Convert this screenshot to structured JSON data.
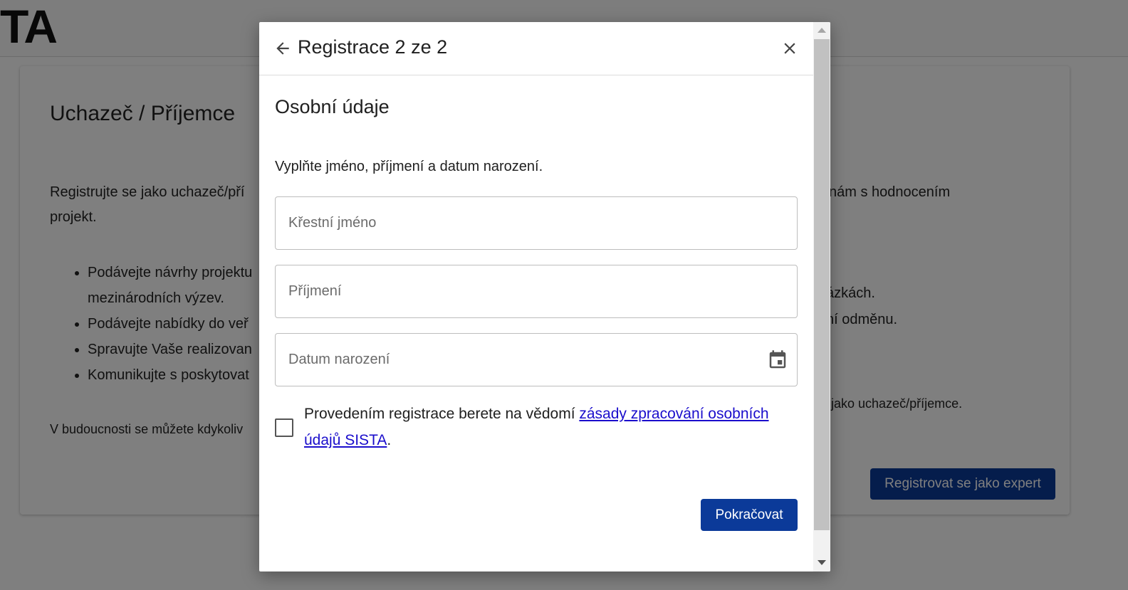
{
  "background": {
    "logo": "TA",
    "card_title": "Uchazeč / Příjemce",
    "paragraph_line1": "Registrujte se jako uchazeč/pří",
    "paragraph_line1_right": "nám s hodnocením",
    "paragraph_line2": "projekt.",
    "list_items": [
      "Podávejte návrhy projektu",
      "mezinárodních výzev.",
      "Podávejte nabídky do veř",
      "Spravujte Vaše realizovan",
      "Komunikujte s poskytovat"
    ],
    "right_text_1": "ázkách.",
    "right_text_2": "ní odměnu.",
    "small_left": "V budoucnosti se můžete kdykoliv",
    "small_right": "i jako uchazeč/příjemce.",
    "expert_button": "Registrovat se jako expert"
  },
  "modal": {
    "title": "Registrace 2 ze 2",
    "section_title": "Osobní údaje",
    "instructions": "Vyplňte jméno, příjmení a datum narození.",
    "fields": {
      "first_name": {
        "placeholder": "Křestní jméno",
        "value": ""
      },
      "last_name": {
        "placeholder": "Příjmení",
        "value": ""
      },
      "birth_date": {
        "placeholder": "Datum narození",
        "value": ""
      }
    },
    "consent": {
      "text_before": "Provedením registrace berete na vědomí ",
      "link_text": "zásady zpracování osobních údajů SISTA",
      "text_after": ".",
      "checked": false
    },
    "continue_button": "Pokračovat"
  },
  "icons": {
    "back": "arrow-left-icon",
    "close": "close-icon",
    "calendar": "calendar-icon"
  },
  "colors": {
    "primary_button": "#0b3a99",
    "link": "#1a0dcc",
    "overlay": "rgba(0,0,0,0.5)"
  }
}
